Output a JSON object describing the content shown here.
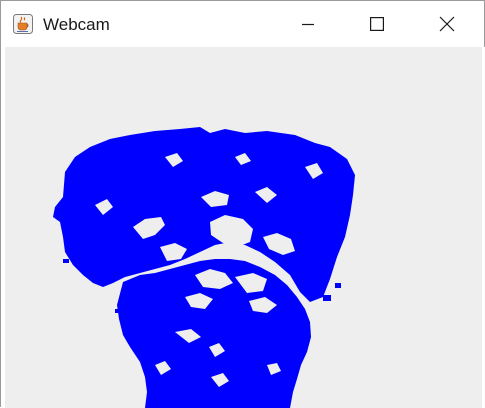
{
  "window": {
    "title": "Webcam",
    "icon": "java-cup-icon"
  },
  "controls": {
    "minimize_icon": "minimize-icon",
    "maximize_icon": "maximize-icon",
    "close_icon": "close-icon"
  },
  "webcam": {
    "image": "blue-threshold-face-silhouette",
    "fill_color": "#0000ff",
    "background_color": "#eeeeee"
  }
}
